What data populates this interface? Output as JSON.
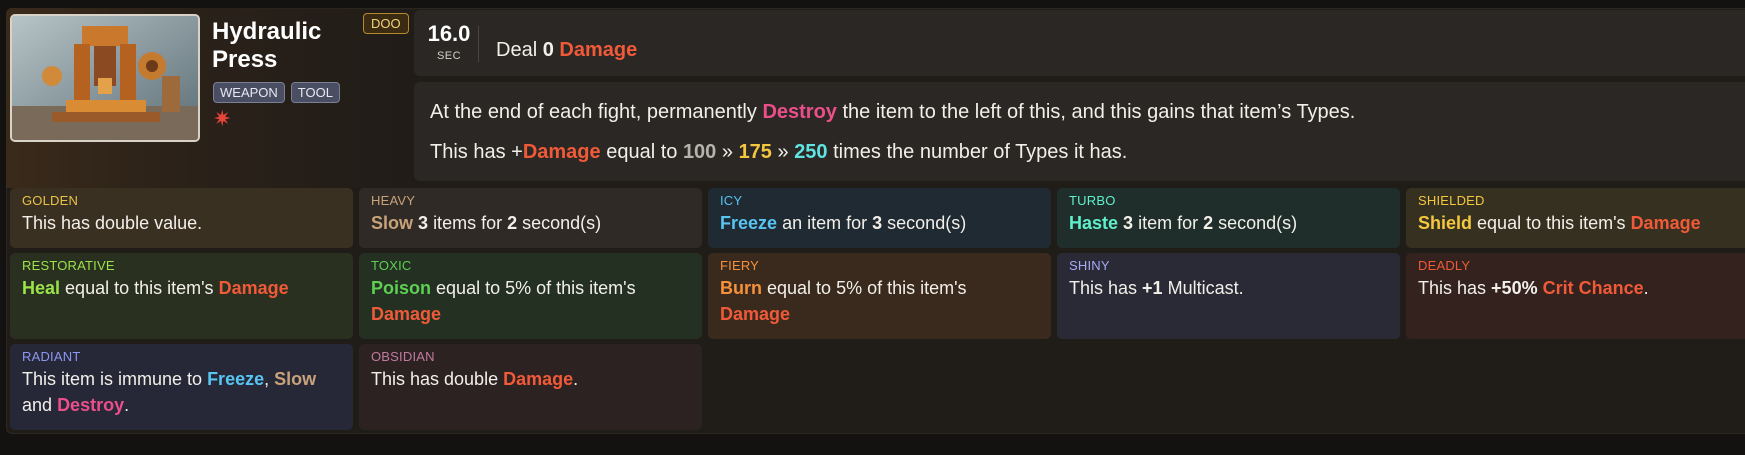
{
  "item": {
    "name": "Hydraulic Press",
    "tags": [
      "WEAPON",
      "TOOL"
    ],
    "badge": "DOO",
    "star_icon": "burst-icon",
    "image_icon": "hydraulic-press-illustration"
  },
  "cooldown": {
    "value": "16.0",
    "unit": "SEC"
  },
  "effect": {
    "prefix": "Deal",
    "amount": "0",
    "word": "Damage"
  },
  "description": {
    "line1": {
      "pre": "At the end of each fight, permanently",
      "keyword": "Destroy",
      "post": "the item to the left of this, and this gains that item’s Types."
    },
    "line2": {
      "pre": "This has +",
      "keyword": "Damage",
      "mid": "equal to",
      "v1": "100",
      "sep1": "»",
      "v2": "175",
      "sep2": "»",
      "v3": "250",
      "post": "times the number of Types it has."
    }
  },
  "enchantments": {
    "golden": {
      "label": "GOLDEN",
      "text": "This has double value."
    },
    "heavy": {
      "label": "HEAVY",
      "kw": "Slow",
      "n": "3",
      "mid": "items for",
      "n2": "2",
      "post": "second(s)"
    },
    "icy": {
      "label": "ICY",
      "kw": "Freeze",
      "mid": "an item for",
      "n": "3",
      "post": "second(s)"
    },
    "turbo": {
      "label": "TURBO",
      "kw": "Haste",
      "n": "3",
      "mid": "item for",
      "n2": "2",
      "post": "second(s)"
    },
    "shielded": {
      "label": "SHIELDED",
      "kw": "Shield",
      "mid": "equal to this item's",
      "kw2": "Damage"
    },
    "restorative": {
      "label": "RESTORATIVE",
      "kw": "Heal",
      "mid": "equal to this item's",
      "kw2": "Damage"
    },
    "toxic": {
      "label": "TOXIC",
      "kw": "Poison",
      "mid": "equal to 5% of this item's",
      "kw2": "Damage"
    },
    "fiery": {
      "label": "FIERY",
      "kw": "Burn",
      "mid": "equal to 5% of this item's",
      "kw2": "Damage"
    },
    "shiny": {
      "label": "SHINY",
      "pre": "This has",
      "n": "+1",
      "post": "Multicast."
    },
    "deadly": {
      "label": "DEADLY",
      "pre": "This has",
      "n": "+50%",
      "kw": "Crit Chance",
      "post": "."
    },
    "radiant": {
      "label": "RADIANT",
      "pre": "This item is immune to",
      "kw1": "Freeze",
      "c1": ",",
      "kw2": "Slow",
      "and": "and",
      "kw3": "Destroy",
      "post": "."
    },
    "obsidian": {
      "label": "OBSIDIAN",
      "pre": "This has double",
      "kw": "Damage",
      "post": "."
    }
  },
  "colors": {
    "damage": "#f05a38",
    "destroy": "#ec4e8a",
    "freeze": "#58c4f2",
    "slow": "#c9a27a",
    "haste": "#5ff0cb",
    "shield": "#f5c73f",
    "heal": "#9be34a",
    "poison": "#5ecf53",
    "burn": "#f5913a"
  }
}
